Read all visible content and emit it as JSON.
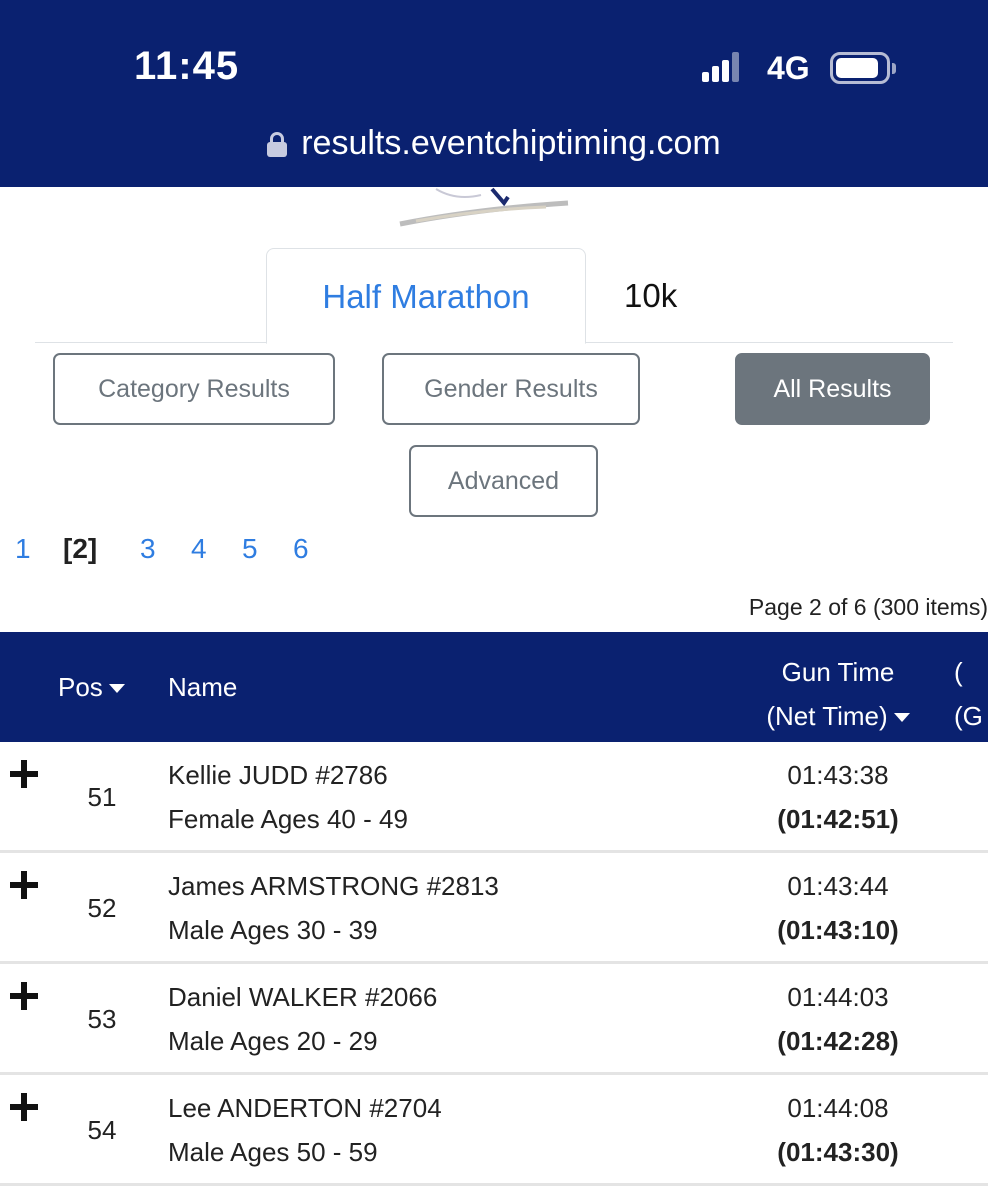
{
  "status_bar": {
    "time": "11:45",
    "network": "4G"
  },
  "browser": {
    "url": "results.eventchiptiming.com"
  },
  "tabs": [
    {
      "label": "Half Marathon",
      "active": true
    },
    {
      "label": "10k",
      "active": false
    }
  ],
  "filters": {
    "category": "Category Results",
    "gender": "Gender Results",
    "all": "All Results",
    "advanced": "Advanced"
  },
  "pagination": {
    "pages": [
      "1",
      "[2]",
      "3",
      "4",
      "5",
      "6"
    ],
    "current_page": "[2]",
    "info": "Page 2 of 6 (300 items)"
  },
  "table": {
    "headers": {
      "pos": "Pos",
      "name": "Name",
      "gun_time": "Gun Time",
      "net_time": "(Net Time)",
      "cut_top": "(",
      "cut_bottom": "(G"
    },
    "rows": [
      {
        "pos": "51",
        "name": "Kellie JUDD #2786",
        "category": "Female Ages 40 - 49",
        "gun": "01:43:38",
        "net": "(01:42:51)"
      },
      {
        "pos": "52",
        "name": "James ARMSTRONG #2813",
        "category": "Male Ages 30 - 39",
        "gun": "01:43:44",
        "net": "(01:43:10)"
      },
      {
        "pos": "53",
        "name": "Daniel WALKER #2066",
        "category": "Male Ages 20 - 29",
        "gun": "01:44:03",
        "net": "(01:42:28)"
      },
      {
        "pos": "54",
        "name": "Lee ANDERTON #2704",
        "category": "Male Ages 50 - 59",
        "gun": "01:44:08",
        "net": "(01:43:30)"
      }
    ]
  },
  "colors": {
    "header_bg": "#0a2170",
    "link": "#2f7de1",
    "button_gray": "#6c757d"
  }
}
